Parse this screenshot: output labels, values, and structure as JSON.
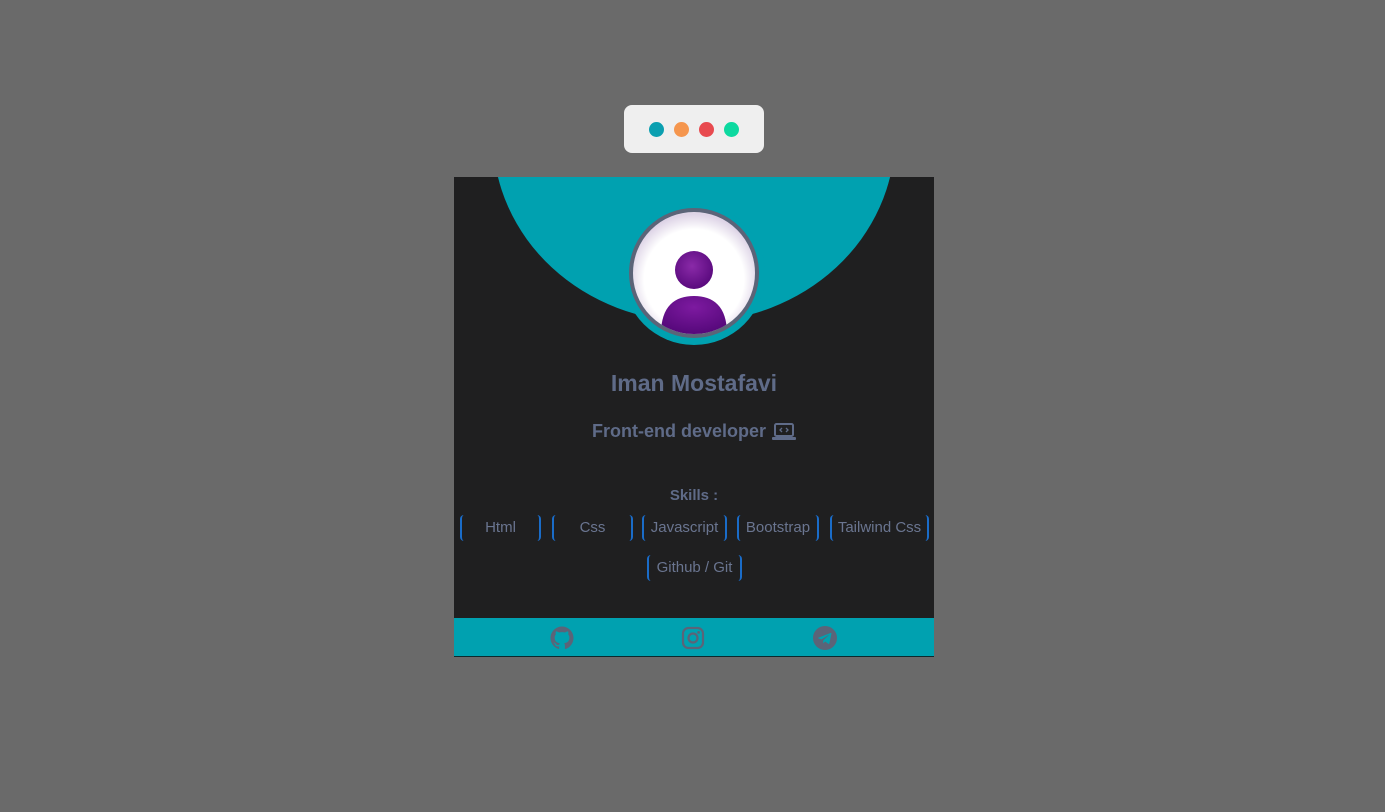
{
  "window_controls": [
    {
      "name": "teal-dot",
      "color": "#0b9fb0"
    },
    {
      "name": "orange-dot",
      "color": "#f5964e"
    },
    {
      "name": "red-dot",
      "color": "#e84a4f"
    },
    {
      "name": "green-dot",
      "color": "#0dd9a0"
    }
  ],
  "profile": {
    "name": "Iman Mostafavi",
    "role": "Front-end developer",
    "role_icon": "laptop-code-icon",
    "avatar_icon": "user-avatar-icon"
  },
  "skills": {
    "title": "Skills :",
    "items": [
      "Html",
      "Css",
      "Javascript",
      "Bootstrap",
      "Tailwind Css",
      "Github / Git"
    ]
  },
  "social": [
    {
      "name": "github",
      "icon": "github-icon"
    },
    {
      "name": "instagram",
      "icon": "instagram-icon"
    },
    {
      "name": "telegram",
      "icon": "telegram-icon"
    }
  ],
  "colors": {
    "accent": "#00a1b0",
    "card_bg": "#1f1f20",
    "page_bg": "#6a6a6a",
    "text": "#5f6b88",
    "skill_border": "#1a6cc8",
    "avatar_purple": "#6b0f8e"
  }
}
